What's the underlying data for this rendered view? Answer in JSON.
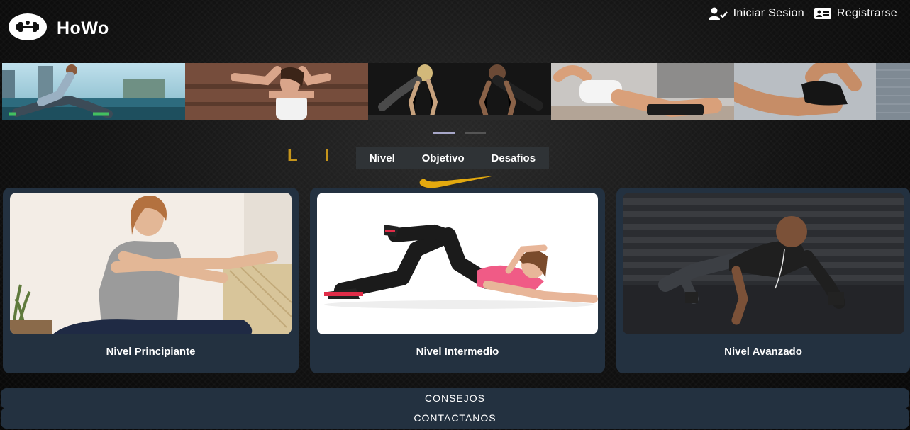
{
  "brand": {
    "name": "HoWo"
  },
  "auth": {
    "login_label": "Iniciar Sesion",
    "register_label": "Registrarse"
  },
  "carousel": {
    "slides": 5,
    "active_indicator": 0
  },
  "background_word": "LIVING",
  "submenu": {
    "items": [
      "Nivel",
      "Objetivo",
      "Desafios"
    ]
  },
  "cards": [
    {
      "title": "Nivel Principiante"
    },
    {
      "title": "Nivel Intermedio"
    },
    {
      "title": "Nivel Avanzado"
    }
  ],
  "footer": {
    "tips_label": "CONSEJOS",
    "contact_label": "CONTACTANOS"
  },
  "colors": {
    "card_bg": "#233140",
    "accent_gold": "#d8a21b",
    "submenu_bg": "#2f3336"
  }
}
